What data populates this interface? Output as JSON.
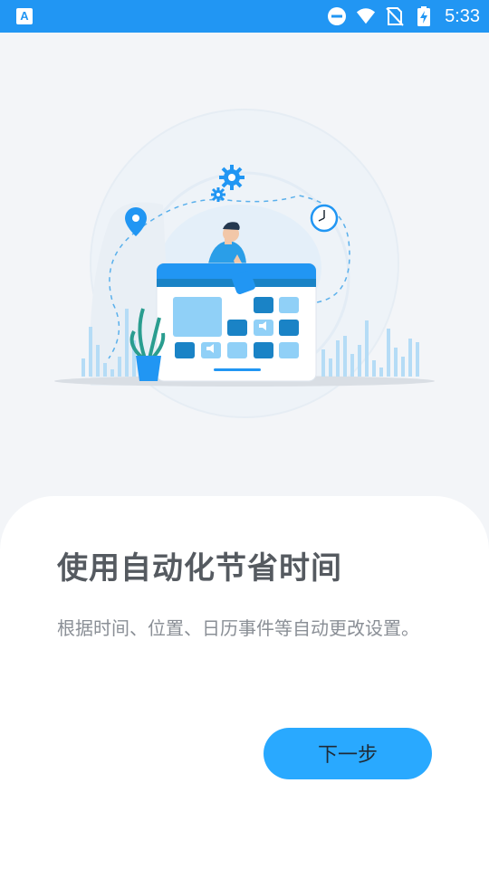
{
  "status_bar": {
    "app_icon_letter": "A",
    "time": "5:33",
    "icons": [
      "dnd-icon",
      "wifi-icon",
      "no-sim-icon",
      "battery-charging-icon"
    ]
  },
  "illustration": {
    "name": "automation-illustration",
    "colors": {
      "primary": "#2196f3",
      "light": "#90d0f7",
      "dark": "#1a83c6"
    }
  },
  "onboarding": {
    "title": "使用自动化节省时间",
    "description": "根据时间、位置、日历事件等自动更改设置。",
    "next_label": "下一步"
  },
  "theme": {
    "accent": "#29a9ff",
    "status_bar": "#2196f3"
  }
}
